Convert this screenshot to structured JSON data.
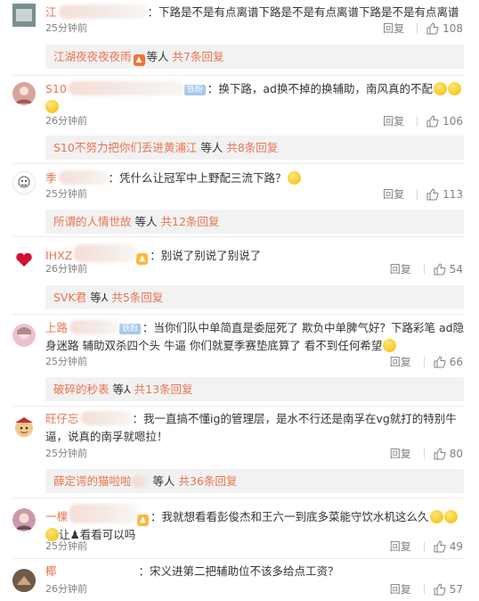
{
  "colors": {
    "link": "#eb7350",
    "muted": "#808080",
    "text": "#333333",
    "subreply_bg": "#f2f2f2"
  },
  "comments": [
    {
      "username": "江",
      "text": "下路是不是有点离谱下路是不是有点离谱下路是不是有点离谱",
      "time": "25分钟前",
      "reply_label": "回复",
      "likes": "108",
      "avatar_icon": "user-avatar-icon",
      "subreply": {
        "name": "江湖夜夜夜夜雨",
        "etc": "等人",
        "count": "共7条回复"
      }
    },
    {
      "username": "S10",
      "text_line1": "换下路，ad换不掉的换辅助，南风真的不配",
      "time": "26分钟前",
      "reply_label": "回复",
      "likes": "106",
      "avatar_icon": "user-avatar-icon",
      "subreply": {
        "name": "S10不努力把你们丢进黄浦江",
        "etc": "等人",
        "count": "共8条回复"
      }
    },
    {
      "username": "季",
      "text": "凭什么让冠军中上野配三流下路？",
      "time": "25分钟前",
      "reply_label": "回复",
      "likes": "113",
      "avatar_icon": "user-avatar-icon",
      "subreply": {
        "name": "所谓的人情世故",
        "etc": "等人",
        "count": "共12条回复"
      }
    },
    {
      "username": "IHXZ",
      "text": "别说了别说了别说了",
      "time": "26分钟前",
      "reply_label": "回复",
      "likes": "54",
      "avatar_icon": "heart-avatar-icon",
      "subreply": {
        "name": "SVK君",
        "etc": "等",
        "count": "共5条回复"
      }
    },
    {
      "username": "上路",
      "text_line1": "当你们队中单简直是委屈死了 欺负中单脾气好？下路彩笔  ad隐",
      "text_line2": "身迷路 辅助双杀四个头 牛逼 你们就夏季赛垫底算了 看不到任何希望",
      "time": "25分钟前",
      "reply_label": "回复",
      "likes": "66",
      "avatar_icon": "user-avatar-icon",
      "subreply": {
        "name": "破碎的秒表",
        "etc": "等",
        "count": "共13条回复"
      }
    },
    {
      "username": "旺仔忘",
      "text_line1": "我一直搞不懂ig的管理层，是水不行还是南孚在vg就打的特别牛",
      "text_line2": "逼，说真的南孚就嗯拉！",
      "time": "25分钟前",
      "reply_label": "回复",
      "likes": "80",
      "avatar_icon": "user-avatar-icon",
      "subreply": {
        "name": "薛定谔的猫啦啦",
        "etc": "等人",
        "count": "共36条回复"
      }
    },
    {
      "username": "一棵",
      "text_line1": "我就想看看彭俊杰和王六一到底多菜能守饮水机这么久",
      "text_line2": "让",
      "text_line2b": "看看可以吗",
      "time": "25分钟前",
      "reply_label": "回复",
      "likes": "49",
      "avatar_icon": "user-avatar-icon"
    },
    {
      "username": "椰",
      "text": "宋义进第二把辅助位不该多给点工资？",
      "time": "26分钟前",
      "reply_label": "回复",
      "likes": "57",
      "avatar_icon": "user-avatar-icon"
    }
  ]
}
